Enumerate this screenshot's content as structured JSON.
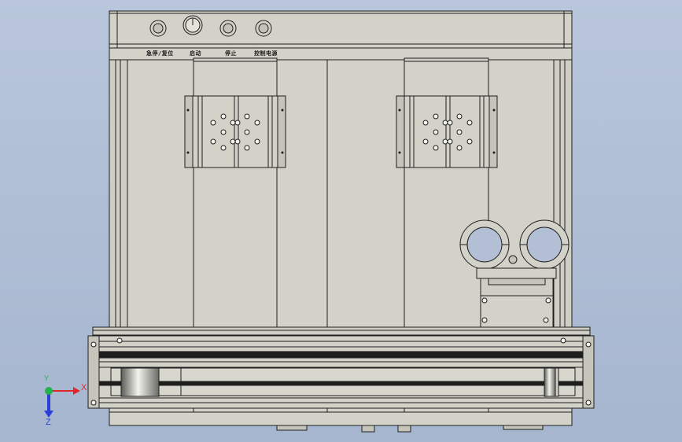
{
  "viewport": {
    "background": "#b0bed5",
    "panel_labels": [
      "急停/复位",
      "启动",
      "停止",
      "控制电源"
    ]
  },
  "triad": {
    "x_label": "X",
    "y_label": "Y",
    "z_label": "Z",
    "x_color": "#e0262a",
    "y_color": "#22b14c",
    "z_color": "#2b3fd6"
  },
  "colors": {
    "panel": "#d3d2c8",
    "line": "#1f1f1f"
  }
}
